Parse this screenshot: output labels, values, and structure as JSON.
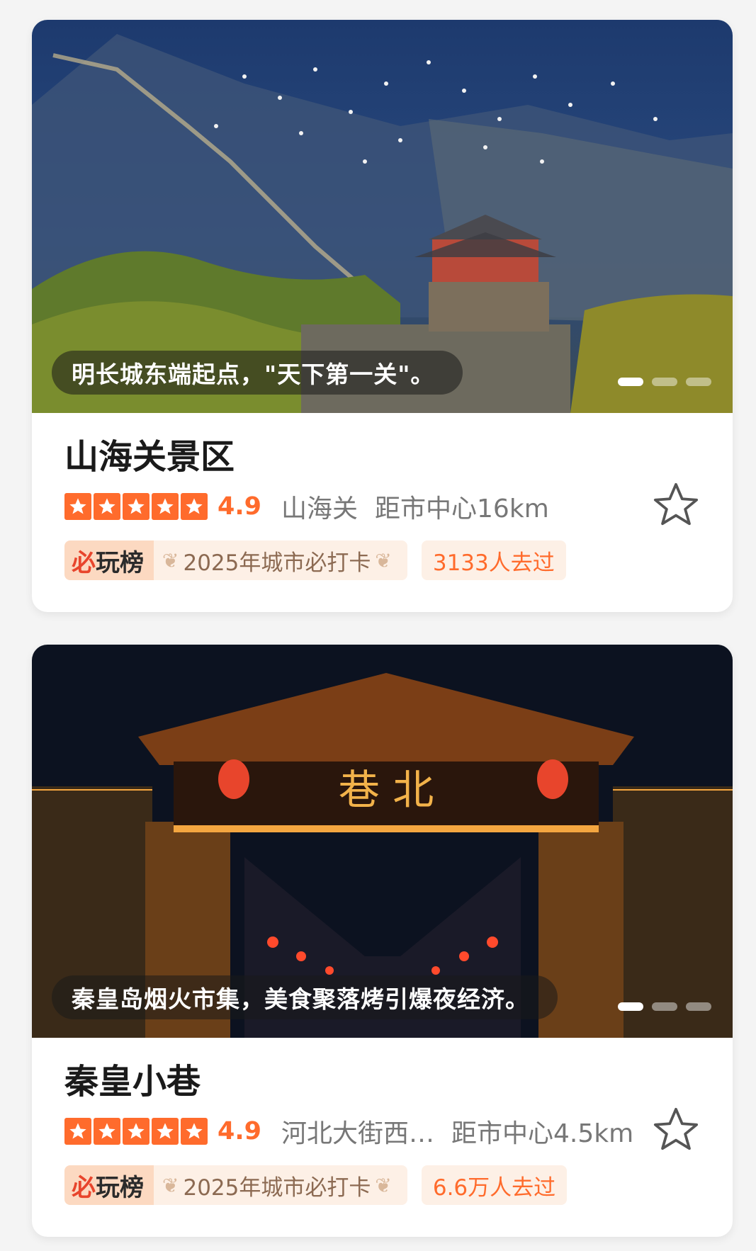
{
  "cards": [
    {
      "caption": "明长城东端起点，\"天下第一关\"。",
      "title": "山海关景区",
      "rating": "4.9",
      "location": "山海关",
      "distance": "距市中心16km",
      "rank_logo_prefix": "必",
      "rank_logo_suffix": "玩榜",
      "rank_text": "2025年城市必打卡",
      "visits": "3133人去过",
      "image_icon": "great-wall-photo",
      "carousel_active_index": 0,
      "carousel_count": 3
    },
    {
      "caption": "秦皇岛烟火市集，美食聚落烤引爆夜经济。",
      "title": "秦皇小巷",
      "rating": "4.9",
      "location": "河北大街西…",
      "distance": "距市中心4.5km",
      "rank_logo_prefix": "必",
      "rank_logo_suffix": "玩榜",
      "rank_text": "2025年城市必打卡",
      "visits": "6.6万人去过",
      "image_icon": "night-gate-photo",
      "sign_text": "巷 北",
      "carousel_active_index": 0,
      "carousel_count": 3
    }
  ],
  "colors": {
    "accent": "#ff6b2c",
    "tag_bg": "#fdf0e6",
    "rank_logo_bg": "#fcd9c1"
  }
}
